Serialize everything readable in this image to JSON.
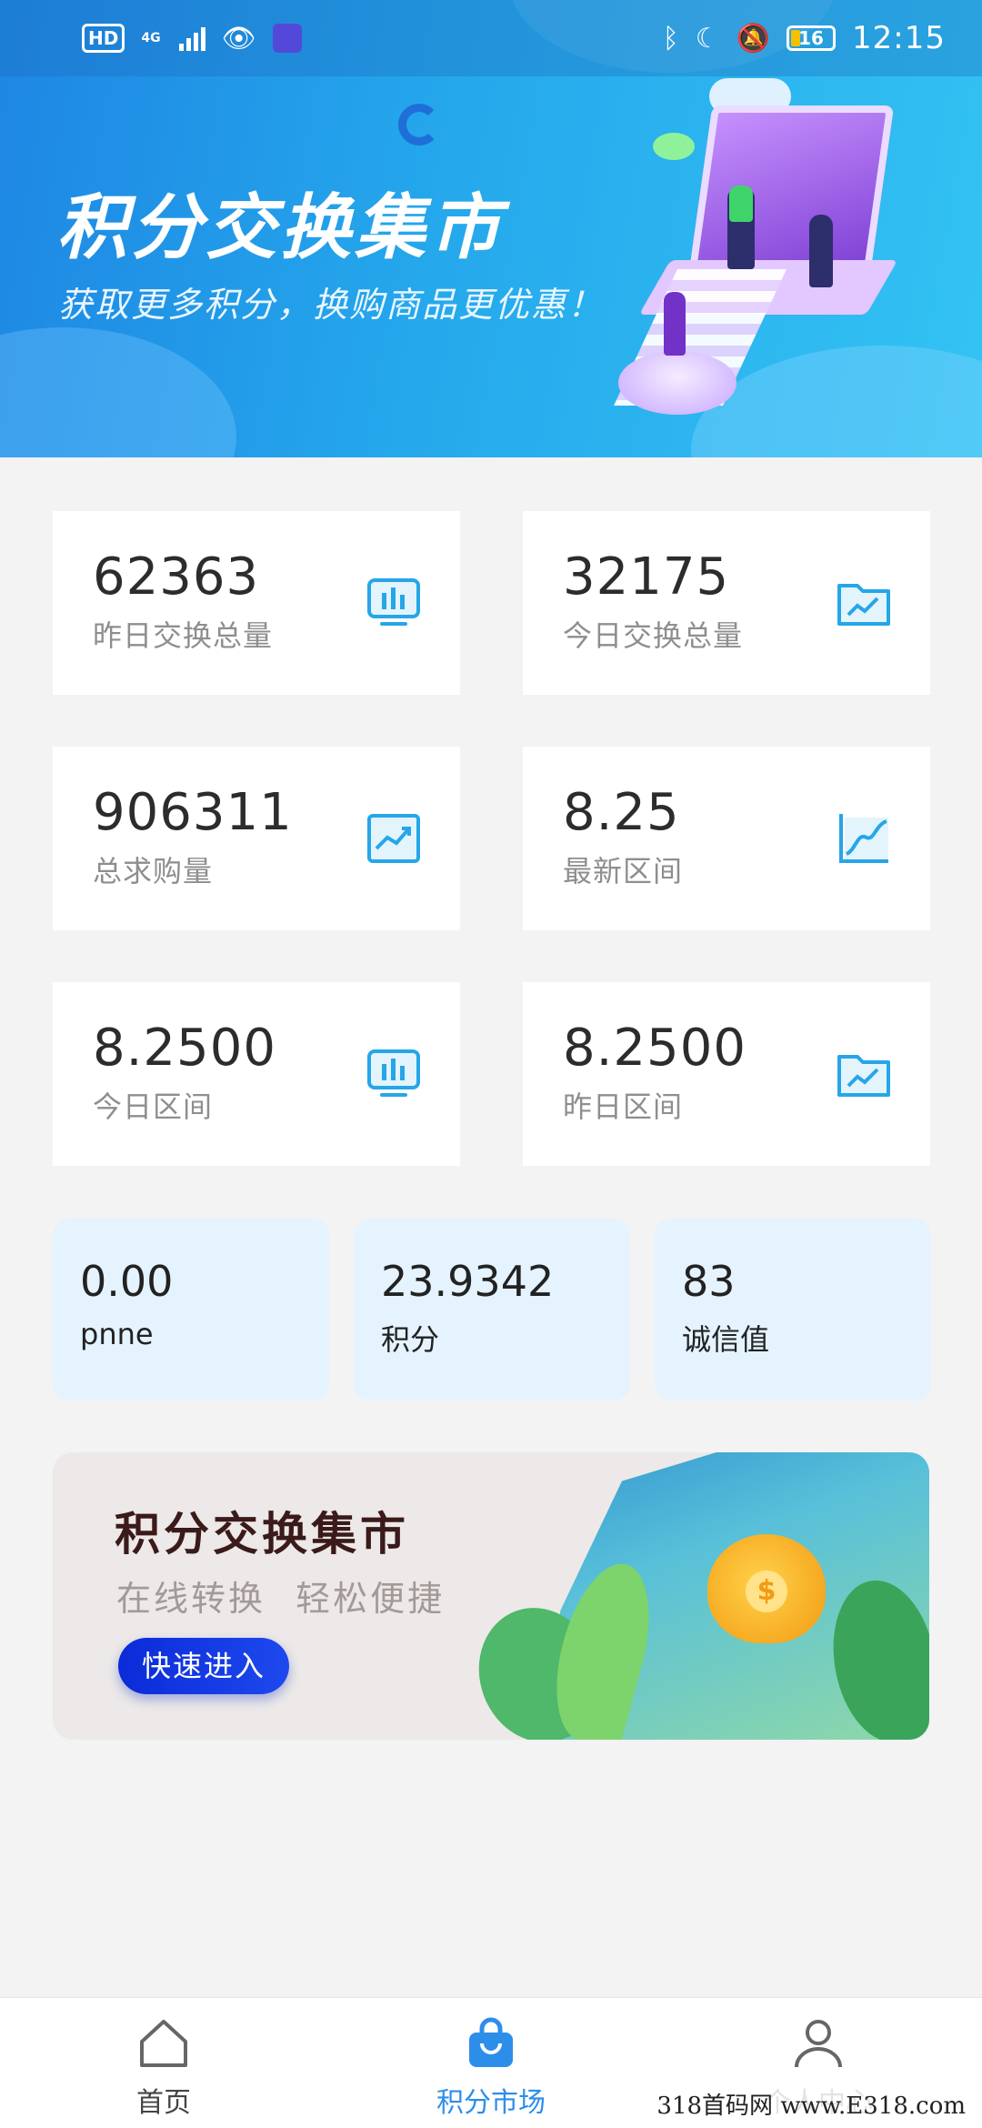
{
  "status_bar": {
    "left_chip": "HD",
    "network": "4G",
    "time": "12:15",
    "battery": "16"
  },
  "hero": {
    "title": "积分交换集市",
    "subtitle": "获取更多积分，换购商品更优惠！"
  },
  "stats": [
    {
      "value": "62363",
      "label": "昨日交换总量",
      "icon": "monitor-chart-icon"
    },
    {
      "value": "32175",
      "label": "今日交换总量",
      "icon": "folder-chart-icon"
    },
    {
      "value": "906311",
      "label": "总求购量",
      "icon": "trend-chart-icon"
    },
    {
      "value": "8.25",
      "label": "最新区间",
      "icon": "line-chart-icon"
    },
    {
      "value": "8.2500",
      "label": "今日区间",
      "icon": "monitor-chart-icon"
    },
    {
      "value": "8.2500",
      "label": "昨日区间",
      "icon": "folder-chart-icon"
    }
  ],
  "balances": [
    {
      "value": "0.00",
      "label": "pnne"
    },
    {
      "value": "23.9342",
      "label": "积分"
    },
    {
      "value": "83",
      "label": "诚信值"
    }
  ],
  "promo": {
    "title": "积分交换集市",
    "subtitle": "在线转换  轻松便捷",
    "button": "快速进入"
  },
  "nav": {
    "items": [
      {
        "label": "首页",
        "icon": "home-icon",
        "active": false
      },
      {
        "label": "积分市场",
        "icon": "shopping-bag-icon",
        "active": true
      },
      {
        "label": "个人中心",
        "icon": "user-icon",
        "active": false
      }
    ]
  },
  "watermark": "318首码网 www.E318.com",
  "colors": {
    "accent": "#2d8eea",
    "icon_blue": "#26a6e8",
    "button_blue": "#1233dd",
    "mini_card_bg": "#e4f3fe",
    "page_bg": "#f3f3f4"
  }
}
